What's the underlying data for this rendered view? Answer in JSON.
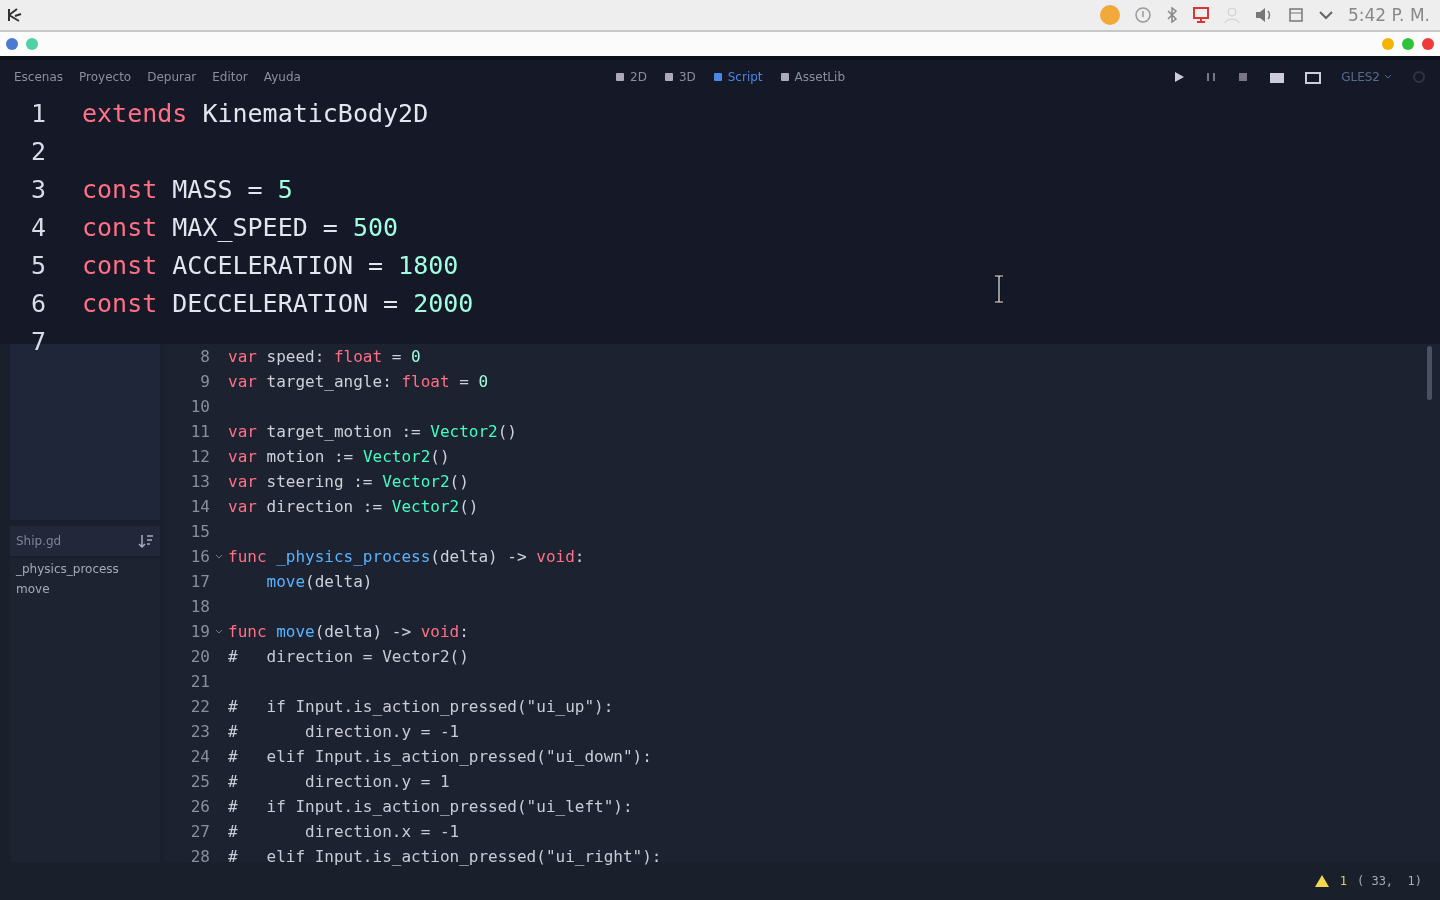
{
  "system_bar": {
    "clock": "5:42 P. M."
  },
  "menu": [
    "Escenas",
    "Proyecto",
    "Depurar",
    "Editor",
    "Ayuda"
  ],
  "workspaces": [
    {
      "label": "2D",
      "selected": false
    },
    {
      "label": "3D",
      "selected": false
    },
    {
      "label": "Script",
      "selected": true
    },
    {
      "label": "AssetLib",
      "selected": false
    }
  ],
  "renderer": "GLES2",
  "zoomed_code": [
    {
      "n": "1",
      "tokens": [
        {
          "kind": "kw",
          "text": "extends"
        },
        {
          "kind": "plain",
          "text": " KinematicBody2D"
        }
      ]
    },
    {
      "n": "2"
    },
    {
      "n": "3",
      "tokens": [
        {
          "kind": "kw",
          "text": "const"
        },
        {
          "kind": "plain",
          "text": " MASS = "
        },
        {
          "kind": "num",
          "text": "5"
        }
      ]
    },
    {
      "n": "4",
      "tokens": [
        {
          "kind": "kw",
          "text": "const"
        },
        {
          "kind": "plain",
          "text": " MAX_SPEED = "
        },
        {
          "kind": "num",
          "text": "500"
        }
      ]
    },
    {
      "n": "5",
      "tokens": [
        {
          "kind": "kw",
          "text": "const"
        },
        {
          "kind": "plain",
          "text": " ACCELERATION = "
        },
        {
          "kind": "num",
          "text": "1800"
        }
      ]
    },
    {
      "n": "6",
      "tokens": [
        {
          "kind": "kw",
          "text": "const"
        },
        {
          "kind": "plain",
          "text": " DECCELERATION = "
        },
        {
          "kind": "num",
          "text": "2000"
        }
      ]
    },
    {
      "n": "7"
    }
  ],
  "script_panel": {
    "filter": "Ship.gd",
    "methods": [
      "_physics_process",
      "move"
    ]
  },
  "code": [
    {
      "n": "8",
      "fold": false,
      "tokens": [
        {
          "kind": "kw",
          "text": "var"
        },
        {
          "kind": "plain",
          "text": " speed: "
        },
        {
          "kind": "kw",
          "text": "float"
        },
        {
          "kind": "plain",
          "text": " = "
        },
        {
          "kind": "num",
          "text": "0"
        }
      ]
    },
    {
      "n": "9",
      "fold": false,
      "tokens": [
        {
          "kind": "kw",
          "text": "var"
        },
        {
          "kind": "plain",
          "text": " target_angle: "
        },
        {
          "kind": "kw",
          "text": "float"
        },
        {
          "kind": "plain",
          "text": " = "
        },
        {
          "kind": "num",
          "text": "0"
        }
      ]
    },
    {
      "n": "10",
      "fold": false
    },
    {
      "n": "11",
      "fold": false,
      "tokens": [
        {
          "kind": "kw",
          "text": "var"
        },
        {
          "kind": "plain",
          "text": " target_motion := "
        },
        {
          "kind": "type",
          "text": "Vector2"
        },
        {
          "kind": "plain",
          "text": "()"
        }
      ]
    },
    {
      "n": "12",
      "fold": false,
      "tokens": [
        {
          "kind": "kw",
          "text": "var"
        },
        {
          "kind": "plain",
          "text": " motion := "
        },
        {
          "kind": "type",
          "text": "Vector2"
        },
        {
          "kind": "plain",
          "text": "()"
        }
      ]
    },
    {
      "n": "13",
      "fold": false,
      "tokens": [
        {
          "kind": "kw",
          "text": "var"
        },
        {
          "kind": "plain",
          "text": " steering := "
        },
        {
          "kind": "type",
          "text": "Vector2"
        },
        {
          "kind": "plain",
          "text": "()"
        }
      ]
    },
    {
      "n": "14",
      "fold": false,
      "tokens": [
        {
          "kind": "kw",
          "text": "var"
        },
        {
          "kind": "plain",
          "text": " direction := "
        },
        {
          "kind": "type",
          "text": "Vector2"
        },
        {
          "kind": "plain",
          "text": "()"
        }
      ]
    },
    {
      "n": "15",
      "fold": false
    },
    {
      "n": "16",
      "fold": true,
      "tokens": [
        {
          "kind": "kw",
          "text": "func"
        },
        {
          "kind": "fn",
          "text": " _physics_process"
        },
        {
          "kind": "plain",
          "text": "(delta) -> "
        },
        {
          "kind": "kw",
          "text": "void"
        },
        {
          "kind": "plain",
          "text": ":"
        }
      ]
    },
    {
      "n": "17",
      "fold": false,
      "tokens": [
        {
          "kind": "fn",
          "text": "    move"
        },
        {
          "kind": "plain",
          "text": "(delta)"
        }
      ]
    },
    {
      "n": "18",
      "fold": false
    },
    {
      "n": "19",
      "fold": true,
      "tokens": [
        {
          "kind": "kw",
          "text": "func"
        },
        {
          "kind": "fn",
          "text": " move"
        },
        {
          "kind": "plain",
          "text": "(delta) -> "
        },
        {
          "kind": "kw",
          "text": "void"
        },
        {
          "kind": "plain",
          "text": ":"
        }
      ]
    },
    {
      "n": "20",
      "fold": false,
      "tokens": [
        {
          "kind": "comment",
          "text": "#   direction = Vector2()"
        }
      ]
    },
    {
      "n": "21",
      "fold": false
    },
    {
      "n": "22",
      "fold": false,
      "tokens": [
        {
          "kind": "comment",
          "text": "#   if Input.is_action_pressed(\"ui_up\"):"
        }
      ]
    },
    {
      "n": "23",
      "fold": false,
      "tokens": [
        {
          "kind": "comment",
          "text": "#       direction.y = -1"
        }
      ]
    },
    {
      "n": "24",
      "fold": false,
      "tokens": [
        {
          "kind": "comment",
          "text": "#   elif Input.is_action_pressed(\"ui_down\"):"
        }
      ]
    },
    {
      "n": "25",
      "fold": false,
      "tokens": [
        {
          "kind": "comment",
          "text": "#       direction.y = 1"
        }
      ]
    },
    {
      "n": "26",
      "fold": false,
      "tokens": [
        {
          "kind": "comment",
          "text": "#   if Input.is_action_pressed(\"ui_left\"):"
        }
      ]
    },
    {
      "n": "27",
      "fold": false,
      "tokens": [
        {
          "kind": "comment",
          "text": "#       direction.x = -1"
        }
      ]
    },
    {
      "n": "28",
      "fold": false,
      "tokens": [
        {
          "kind": "comment",
          "text": "#   elif Input.is_action_pressed(\"ui_right\"):"
        }
      ]
    }
  ],
  "status_bar": {
    "warnings": "1",
    "position": "( 33,  1)"
  }
}
